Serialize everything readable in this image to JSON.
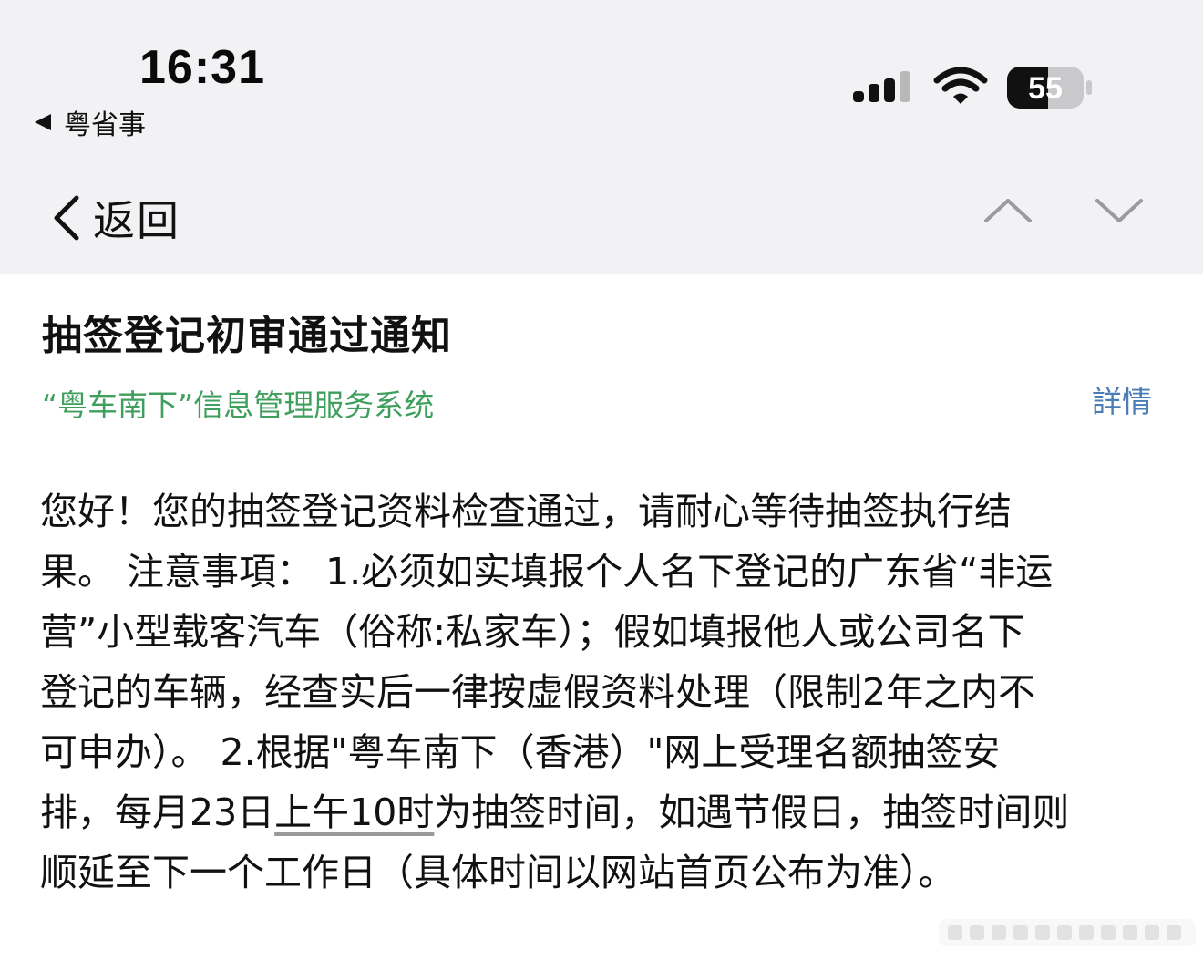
{
  "status_bar": {
    "time": "16:31",
    "back_app_label": "粤省事",
    "battery_level": "55",
    "icons": [
      "signal-icon",
      "wifi-icon",
      "battery-icon"
    ]
  },
  "nav": {
    "back_label": "返回",
    "icons": [
      "chevron-left-icon",
      "chevron-up-icon",
      "chevron-down-icon"
    ]
  },
  "message": {
    "title": "抽签登记初审通过通知",
    "sender": "“粤车南下”信息管理服务系统",
    "details_label": "詳情",
    "body_lines": [
      "您好！您的抽签登记资料检查通过，请耐心等待抽签执行结",
      "果。 注意事項： 1.必须如实填报个人名下登记的广东省“非运",
      "营”小型载客汽车（俗称:私家车）；假如填报他人或公司名下",
      "登记的车辆，经查实后一律按虚假资料处理（限制2年之内不",
      "可申办）。 2.根据\"粤车南下（香港）\"网上受理名额抽签安"
    ],
    "line6_before": "排，每月23日",
    "line6_underlined": "上午10时",
    "line6_after": "为抽签时间，如遇节假日，抽签时间则",
    "line7": "顺延至下一个工作日（具体时间以网站首页公布为准）。"
  },
  "colors": {
    "header_bg": "#f2f2f4",
    "sender_green": "#3f9f5c",
    "details_blue": "#4a7cb5",
    "text": "#111111"
  }
}
